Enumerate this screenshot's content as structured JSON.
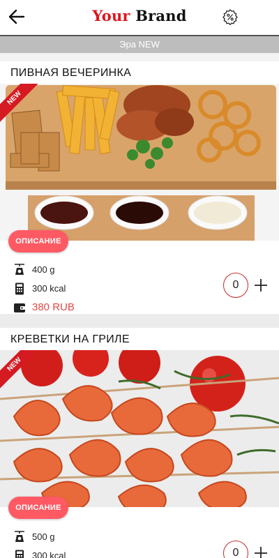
{
  "header": {
    "brand_part1": "Your",
    "brand_part2": "Brand",
    "back_icon": "arrow-left-icon",
    "promo_icon": "percent-badge-icon"
  },
  "subheader": {
    "label": "Эра NEW"
  },
  "products": [
    {
      "title": "ПИВНАЯ ВЕЧЕРИНКА",
      "badge": "NEW",
      "description_button": "ОПИСАНИЕ",
      "weight": "400 g",
      "calories": "300 kcal",
      "price": "380 RUB",
      "quantity": "0"
    },
    {
      "title": "КРЕВЕТКИ НА ГРИЛЕ",
      "badge": "NEW",
      "description_button": "ОПИСАНИЕ",
      "weight": "500 g",
      "calories": "300 kcal",
      "quantity": "0"
    }
  ],
  "colors": {
    "brand_red": "#e0141e",
    "button_pink": "#ff5a64",
    "price_red": "#e04848",
    "ribbon_red": "#d61a22"
  }
}
